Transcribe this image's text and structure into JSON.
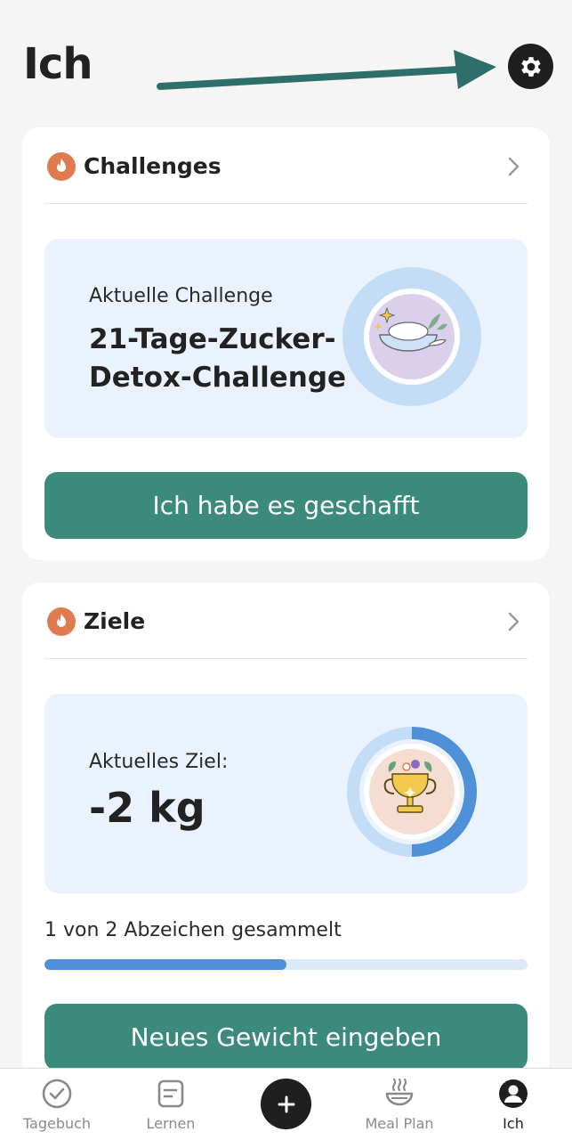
{
  "header": {
    "title": "Ich",
    "settings_icon": "gear-icon"
  },
  "challenges": {
    "title": "Challenges",
    "current_label": "Aktuelle Challenge",
    "current_name_line1": "21-Tage-Zucker-",
    "current_name_line2": "Detox-Challenge",
    "button_label": "Ich habe es geschafft"
  },
  "goals": {
    "title": "Ziele",
    "current_label": "Aktuelles Ziel:",
    "current_value": "-2 kg",
    "goal_progress": 0.5,
    "badges_text": "1 von 2 Abzeichen gesammelt",
    "badges_progress": 0.5,
    "button_label": "Neues Gewicht eingeben"
  },
  "tabbar": {
    "tabs": [
      {
        "label": "Tagebuch",
        "icon": "check-circle-icon"
      },
      {
        "label": "Lernen",
        "icon": "document-icon"
      },
      {
        "label": "",
        "icon": "plus-icon"
      },
      {
        "label": "Meal Plan",
        "icon": "bowl-icon"
      },
      {
        "label": "Ich",
        "icon": "profile-icon",
        "active": true
      }
    ]
  },
  "colors": {
    "accent_green": "#3c8a7b",
    "progress_blue": "#4f90d9",
    "flame_orange": "#e07a4f",
    "info_bg": "#eaf3fd"
  }
}
